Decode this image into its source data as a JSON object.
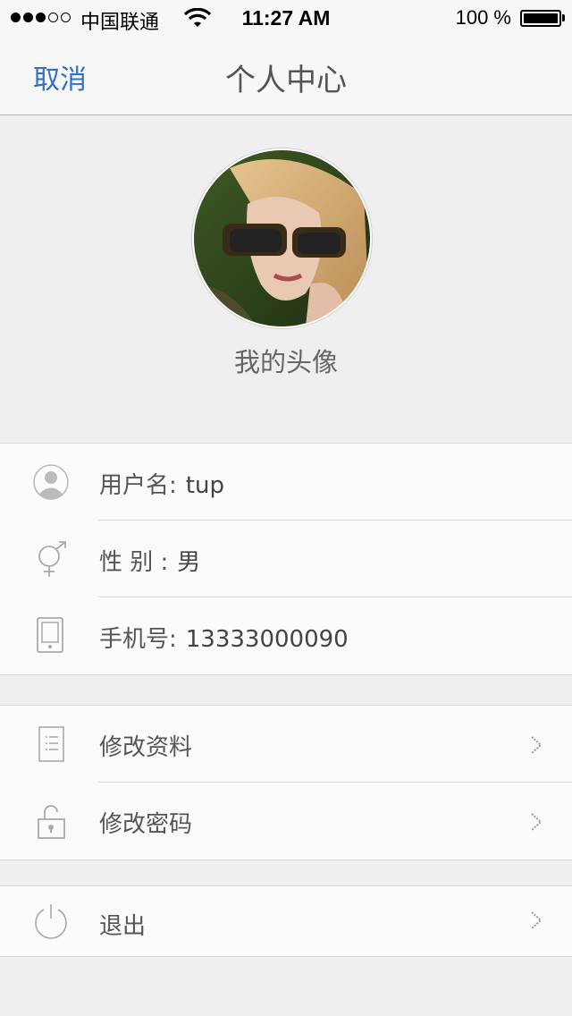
{
  "status_bar": {
    "carrier": "中国联通",
    "time": "11:27 AM",
    "battery": "100 %",
    "signal_strength": 3,
    "icons": [
      "signal-dots-icon",
      "wifi-icon",
      "battery-icon"
    ]
  },
  "nav": {
    "cancel_label": "取消",
    "title": "个人中心"
  },
  "profile": {
    "avatar_caption": "我的头像"
  },
  "info": {
    "username_label": "用户名:",
    "username_value": "tup",
    "gender_label": "性 别 :",
    "gender_value": "男",
    "phone_label": "手机号:",
    "phone_value": "13333000090"
  },
  "actions": {
    "edit_profile": "修改资料",
    "change_password": "修改密码",
    "logout": "退出"
  },
  "colors": {
    "accent": "#2e6fd1",
    "background": "#efefef",
    "cell": "#fbfbfb",
    "icon": "#bbbbbb"
  }
}
